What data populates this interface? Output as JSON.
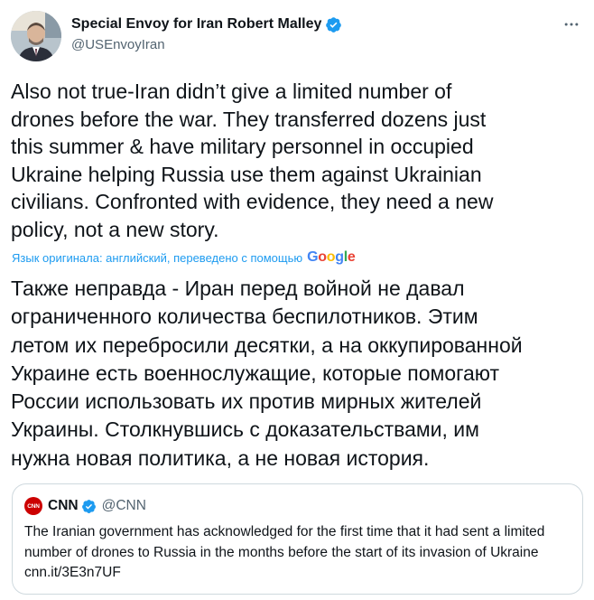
{
  "author": {
    "name": "Special Envoy for Iran Robert Malley",
    "handle": "@USEnvoyIran",
    "verified": true
  },
  "tweet": {
    "text": "Also not true-Iran didn’t give a limited number of\ndrones before the war. They transferred dozens just\nthis summer & have military personnel in occupied\nUkraine helping Russia use them against Ukrainian\ncivilians. Confronted with evidence, they need a new\npolicy, not a new story."
  },
  "translation": {
    "note": "Язык оригинала: английский, переведено с помощью",
    "provider": "Google",
    "text": "Также неправда - Иран перед войной не давал\nограниченного количества беспилотников. Этим\nлетом их перебросили десятки, а на оккупированной\nУкраине есть военнослужащие, которые помогают\nРоссии использовать их против мирных жителей\nУкраины. Столкнувшись с доказательствами, им\nнужна новая политика, а не новая история."
  },
  "quoted": {
    "logo_text": "CNN",
    "name": "CNN",
    "handle": "@CNN",
    "verified": true,
    "text": "The Iranian government has acknowledged for the first time that it had sent a limited number of drones to Russia in the months before the start of its invasion of Ukraine",
    "link": "cnn.it/3E3n7UF"
  },
  "colors": {
    "verified_blue": "#1d9bf0",
    "secondary_text": "#536471",
    "cnn_red": "#cc0000"
  }
}
